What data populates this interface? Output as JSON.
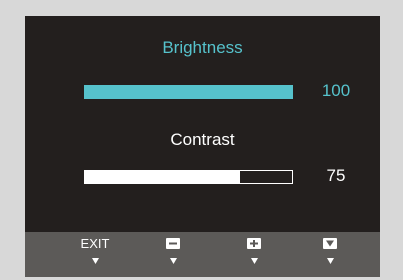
{
  "osd": {
    "brightness": {
      "label": "Brightness",
      "value": "100",
      "level_percent": 100,
      "color": "#56c2cc"
    },
    "contrast": {
      "label": "Contrast",
      "value": "75",
      "level_percent": 75,
      "color": "#ffffff"
    }
  },
  "footer": {
    "exit_label": "EXIT",
    "buttons": [
      {
        "name": "exit",
        "icon": "exit-text"
      },
      {
        "name": "minus",
        "icon": "minus-icon"
      },
      {
        "name": "plus",
        "icon": "plus-icon"
      },
      {
        "name": "down",
        "icon": "down-triangle-icon"
      }
    ]
  },
  "colors": {
    "panel": "#231f1e",
    "footer": "#5c5a58",
    "accent": "#56c2cc",
    "background": "#d8d8d8"
  }
}
